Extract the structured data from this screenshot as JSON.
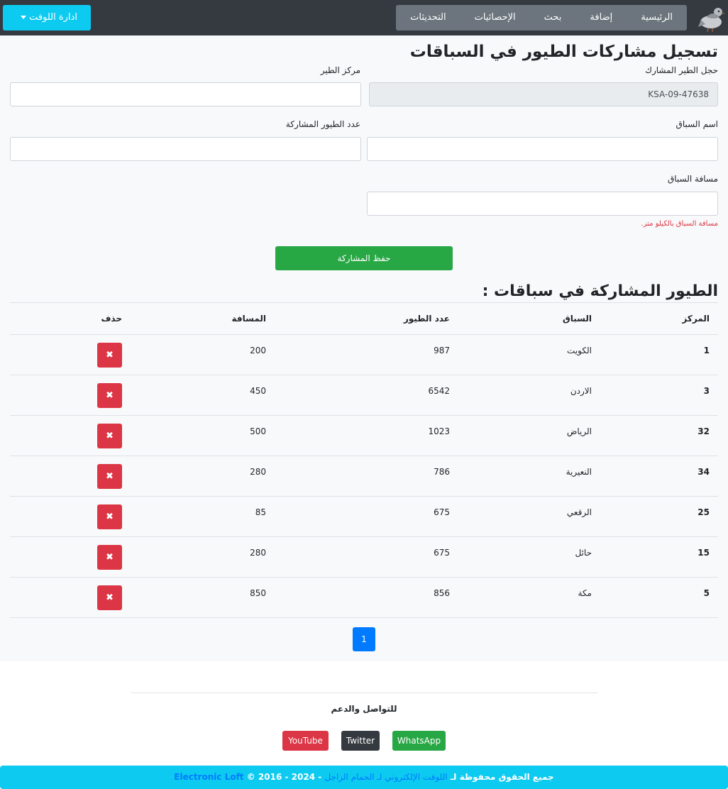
{
  "nav": {
    "items": [
      "الرئيسية",
      "إضافة",
      "بحث",
      "الإحصائيات",
      "التحديثات"
    ],
    "loft_button": "ادارة اللوفت"
  },
  "form": {
    "title": "تسجيل مشاركات الطيور في السباقات",
    "ring_label": "حجل الطير المشارك",
    "ring_value": "KSA-09-47638",
    "position_label": "مركز الطير",
    "race_label": "اسم السباق",
    "count_label": "عدد الطيور المشاركة",
    "distance_label": "مسافة السباق",
    "distance_hint": "مسافة السباق بالكيلو متر.",
    "save_label": "حفظ المشاركة"
  },
  "table": {
    "title": "الطيور المشاركة في سباقات :",
    "headers": {
      "position": "المركز",
      "race": "السباق",
      "count": "عدد الطيور",
      "distance": "المسافة",
      "delete": "حذف"
    },
    "delete_icon": "close-icon",
    "rows": [
      {
        "position": "1",
        "race": "الكويت",
        "count": "987",
        "distance": "200"
      },
      {
        "position": "3",
        "race": "الاردن",
        "count": "6542",
        "distance": "450"
      },
      {
        "position": "32",
        "race": "الرياض",
        "count": "1023",
        "distance": "500"
      },
      {
        "position": "34",
        "race": "النعيرية",
        "count": "786",
        "distance": "280"
      },
      {
        "position": "25",
        "race": "الرقعي",
        "count": "675",
        "distance": "85"
      },
      {
        "position": "15",
        "race": "حائل",
        "count": "675",
        "distance": "280"
      },
      {
        "position": "5",
        "race": "مكة",
        "count": "856",
        "distance": "850"
      }
    ]
  },
  "pagination": {
    "current": "1"
  },
  "footer": {
    "contact": "للتواصل والدعم",
    "social": [
      "WhatsApp",
      "Twitter",
      "YouTube"
    ],
    "copyright_prefix": "جميع الحقوق محفوظة لـ",
    "copyright_site": "اللوفت الإلكتروني لـ الحمام الزاجل",
    "copyright_years": "- 2024 - 2016 ©",
    "copyright_brand": "Electronic Loft"
  },
  "colors": {
    "navbar": "#343a40",
    "accent": "#0dcaf0",
    "save": "#28a745",
    "delete": "#dc3545",
    "pager": "#007bff"
  }
}
